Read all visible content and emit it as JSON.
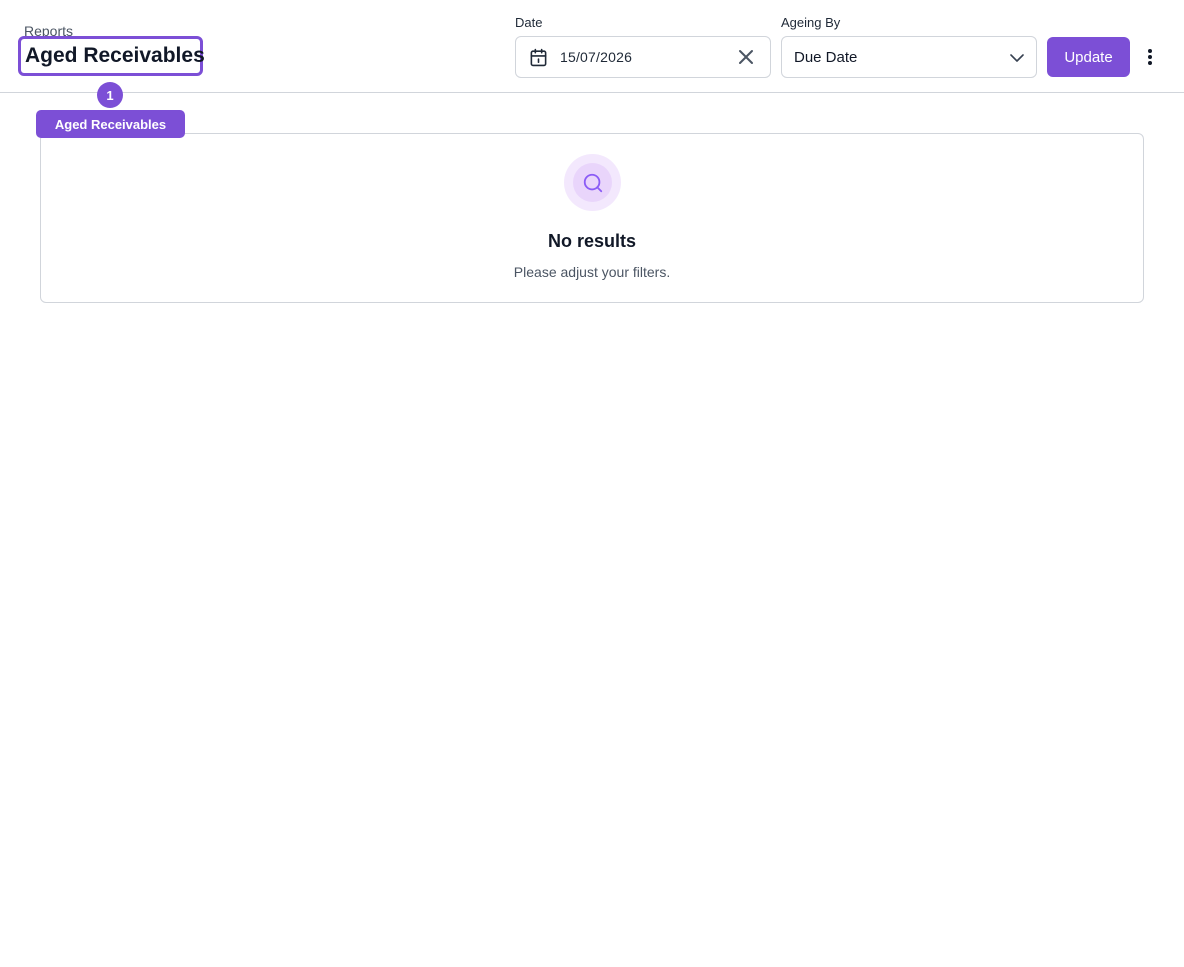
{
  "header": {
    "breadcrumb": "Reports",
    "title": "Aged Receivables"
  },
  "filters": {
    "date_label": "Date",
    "date_value": "15/07/2026",
    "ageing_label": "Ageing By",
    "ageing_value": "Due Date",
    "update_label": "Update"
  },
  "annotation": {
    "number": "1",
    "label": "Aged Receivables"
  },
  "empty_state": {
    "title": "No results",
    "subtitle": "Please adjust your filters."
  },
  "icons": {
    "calendar": "calendar-icon",
    "clear": "close-icon",
    "chevron": "chevron-down-icon",
    "more": "more-vertical-icon",
    "search": "search-icon"
  },
  "colors": {
    "accent": "#7c4fd6",
    "border": "#d1d5db",
    "empty_icon_bg": "#f3e8fd"
  }
}
